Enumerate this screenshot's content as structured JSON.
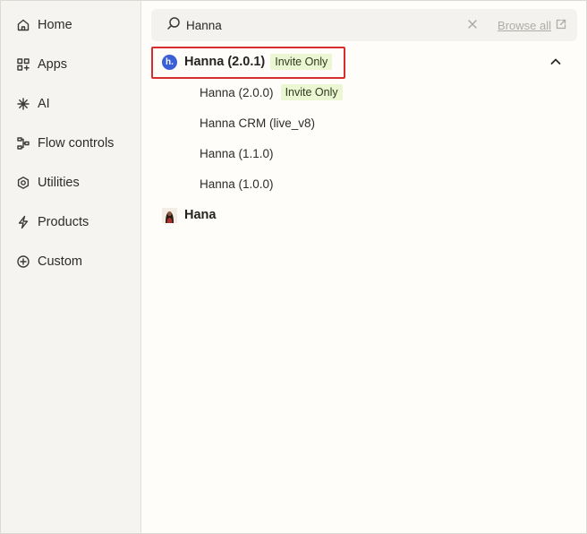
{
  "sidebar": {
    "items": [
      {
        "label": "Home",
        "icon": "home-icon"
      },
      {
        "label": "Apps",
        "icon": "apps-icon"
      },
      {
        "label": "AI",
        "icon": "ai-sparkle-icon"
      },
      {
        "label": "Flow controls",
        "icon": "flow-controls-icon"
      },
      {
        "label": "Utilities",
        "icon": "utilities-icon"
      },
      {
        "label": "Products",
        "icon": "bolt-icon"
      },
      {
        "label": "Custom",
        "icon": "custom-plus-icon"
      }
    ]
  },
  "search": {
    "value": "Hanna",
    "placeholder": "",
    "browse_all_label": "Browse all"
  },
  "results": {
    "primary": {
      "name": "Hanna (2.0.1)",
      "logo_letter": "h.",
      "badge": "Invite Only",
      "expanded": true
    },
    "versions": [
      {
        "label": "Hanna (2.0.0)",
        "badge": "Invite Only"
      },
      {
        "label": "Hanna CRM (live_v8)",
        "badge": ""
      },
      {
        "label": "Hanna (1.1.0)",
        "badge": ""
      },
      {
        "label": "Hanna (1.0.0)",
        "badge": ""
      }
    ],
    "other": {
      "name": "Hana"
    }
  },
  "colors": {
    "accent_logo": "#3a5fd6",
    "badge_bg": "#eaf7d2",
    "highlight_border": "#d62e2e",
    "sidebar_bg": "#f5f4f0",
    "main_bg": "#fffdf9"
  }
}
